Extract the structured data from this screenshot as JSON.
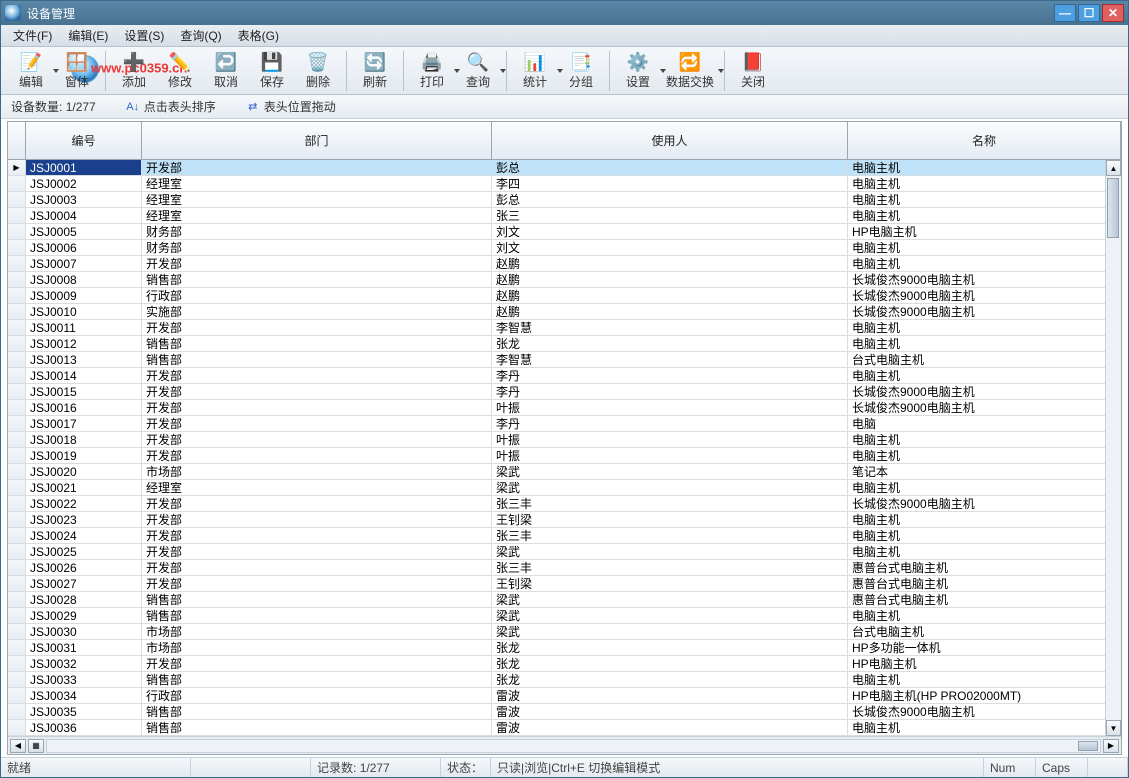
{
  "window": {
    "title": "设备管理"
  },
  "menu": {
    "file": "文件(F)",
    "edit": "编辑(E)",
    "setting": "设置(S)",
    "query": "查询(Q)",
    "table": "表格(G)"
  },
  "toolbar": {
    "edit": "编辑",
    "window": "窗体",
    "add": "添加",
    "modify": "修改",
    "cancel": "取消",
    "save": "保存",
    "delete": "删除",
    "refresh": "刷新",
    "print": "打印",
    "query": "查询",
    "stat": "统计",
    "group": "分组",
    "setup": "设置",
    "exchange": "数据交换",
    "close": "关闭"
  },
  "watermark": "www.pc0359.cn",
  "infobar": {
    "count_label": "设备数量:",
    "count_value": "1/277",
    "hint_sort": "点击表头排序",
    "hint_drag": "表头位置拖动"
  },
  "columns": {
    "c0": "编号",
    "c1": "部门",
    "c2": "使用人",
    "c3": "名称"
  },
  "rows": [
    {
      "id": "JSJ0001",
      "dept": "开发部",
      "user": "彭总",
      "name": "电脑主机"
    },
    {
      "id": "JSJ0002",
      "dept": "经理室",
      "user": "李四",
      "name": "电脑主机"
    },
    {
      "id": "JSJ0003",
      "dept": "经理室",
      "user": "彭总",
      "name": "电脑主机"
    },
    {
      "id": "JSJ0004",
      "dept": "经理室",
      "user": "张三",
      "name": "电脑主机"
    },
    {
      "id": "JSJ0005",
      "dept": "财务部",
      "user": "刘文",
      "name": "HP电脑主机"
    },
    {
      "id": "JSJ0006",
      "dept": "财务部",
      "user": "刘文",
      "name": "电脑主机"
    },
    {
      "id": "JSJ0007",
      "dept": "开发部",
      "user": "赵鹏",
      "name": "电脑主机"
    },
    {
      "id": "JSJ0008",
      "dept": "销售部",
      "user": "赵鹏",
      "name": "长城俊杰9000电脑主机"
    },
    {
      "id": "JSJ0009",
      "dept": "行政部",
      "user": "赵鹏",
      "name": "长城俊杰9000电脑主机"
    },
    {
      "id": "JSJ0010",
      "dept": "实施部",
      "user": "赵鹏",
      "name": "长城俊杰9000电脑主机"
    },
    {
      "id": "JSJ0011",
      "dept": "开发部",
      "user": "李智慧",
      "name": "电脑主机"
    },
    {
      "id": "JSJ0012",
      "dept": "销售部",
      "user": "张龙",
      "name": "电脑主机"
    },
    {
      "id": "JSJ0013",
      "dept": "销售部",
      "user": "李智慧",
      "name": "台式电脑主机"
    },
    {
      "id": "JSJ0014",
      "dept": "开发部",
      "user": "李丹",
      "name": "电脑主机"
    },
    {
      "id": "JSJ0015",
      "dept": "开发部",
      "user": "李丹",
      "name": "长城俊杰9000电脑主机"
    },
    {
      "id": "JSJ0016",
      "dept": "开发部",
      "user": "叶振",
      "name": "长城俊杰9000电脑主机"
    },
    {
      "id": "JSJ0017",
      "dept": "开发部",
      "user": "李丹",
      "name": "电脑"
    },
    {
      "id": "JSJ0018",
      "dept": "开发部",
      "user": "叶振",
      "name": "电脑主机"
    },
    {
      "id": "JSJ0019",
      "dept": "开发部",
      "user": "叶振",
      "name": "电脑主机"
    },
    {
      "id": "JSJ0020",
      "dept": "市场部",
      "user": "梁武",
      "name": "笔记本"
    },
    {
      "id": "JSJ0021",
      "dept": "经理室",
      "user": "梁武",
      "name": "电脑主机"
    },
    {
      "id": "JSJ0022",
      "dept": "开发部",
      "user": "张三丰",
      "name": "长城俊杰9000电脑主机"
    },
    {
      "id": "JSJ0023",
      "dept": "开发部",
      "user": "王钊梁",
      "name": "电脑主机"
    },
    {
      "id": "JSJ0024",
      "dept": "开发部",
      "user": "张三丰",
      "name": "电脑主机"
    },
    {
      "id": "JSJ0025",
      "dept": "开发部",
      "user": "梁武",
      "name": "电脑主机"
    },
    {
      "id": "JSJ0026",
      "dept": "开发部",
      "user": "张三丰",
      "name": "惠普台式电脑主机"
    },
    {
      "id": "JSJ0027",
      "dept": "开发部",
      "user": "王钊梁",
      "name": "惠普台式电脑主机"
    },
    {
      "id": "JSJ0028",
      "dept": "销售部",
      "user": "梁武",
      "name": "惠普台式电脑主机"
    },
    {
      "id": "JSJ0029",
      "dept": "销售部",
      "user": "梁武",
      "name": "电脑主机"
    },
    {
      "id": "JSJ0030",
      "dept": "市场部",
      "user": "梁武",
      "name": "台式电脑主机"
    },
    {
      "id": "JSJ0031",
      "dept": "市场部",
      "user": "张龙",
      "name": "HP多功能一体机"
    },
    {
      "id": "JSJ0032",
      "dept": "开发部",
      "user": "张龙",
      "name": "HP电脑主机"
    },
    {
      "id": "JSJ0033",
      "dept": "销售部",
      "user": "张龙",
      "name": "电脑主机"
    },
    {
      "id": "JSJ0034",
      "dept": "行政部",
      "user": "雷波",
      "name": "HP电脑主机(HP PRO02000MT)"
    },
    {
      "id": "JSJ0035",
      "dept": "销售部",
      "user": "雷波",
      "name": "长城俊杰9000电脑主机"
    },
    {
      "id": "JSJ0036",
      "dept": "销售部",
      "user": "雷波",
      "name": "电脑主机"
    }
  ],
  "status": {
    "ready": "就绪",
    "records_label": "记录数:",
    "records_value": "1/277",
    "state_label": "状态：",
    "mode": "只读|浏览|Ctrl+E 切换编辑模式",
    "num": "Num",
    "caps": "Caps"
  }
}
